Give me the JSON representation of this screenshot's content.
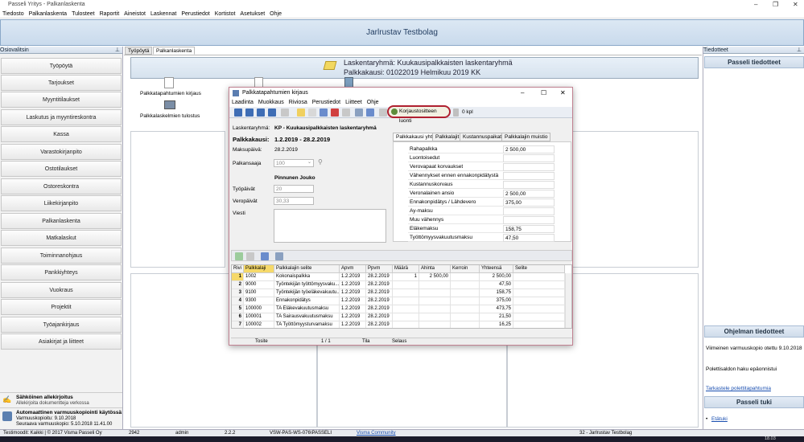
{
  "window": {
    "title": "Passeli Yritys - Palkanlaskenta"
  },
  "menu": [
    "Tiedosto",
    "Palkanlaskenta",
    "Tulosteet",
    "Raportit",
    "Aineistot",
    "Laskennat",
    "Perustiedot",
    "Kortistot",
    "Asetukset",
    "Ohje"
  ],
  "banner": "Jarlrustav Testbolag",
  "left": {
    "title": "Osiovalitsin",
    "items": [
      "Työpöytä",
      "Tarjoukset",
      "Myyntitilaukset",
      "Laskutus ja myyntireskontra",
      "Kassa",
      "Varastokirjanpito",
      "Ostotilaukset",
      "Ostoreskontra",
      "Liikekirjanpito",
      "Palkanlaskenta",
      "Matkalaskut",
      "Toiminnanohjaus",
      "Pankkiyhteys",
      "Vuokraus",
      "Projektit",
      "Työajankirjaus",
      "Asiakirjat ja liitteet"
    ],
    "notice1": {
      "title": "Sähköinen allekirjoitus",
      "text": "Allekirjoita dokumentteja verkossa"
    },
    "notice2": {
      "title": "Automaattinen varmuuskopiointi käytössä",
      "l1": "Varmuuskopioitu: 9.10.2018",
      "l2": "Seuraava varmuuskopio: 5.10.2018 11.41.00"
    }
  },
  "tabs": [
    "Työpöytä",
    "Palkanlaskenta"
  ],
  "header": {
    "l1": "Laskentaryhmä: Kuukausipalkkaisten laskentaryhmä",
    "l2": "Palkkakausi: 01022019 Helmikuu 2019 KK"
  },
  "desk": {
    "i1": "Palkkatapahtumien kirjaus",
    "i2": "Palkkalaskelmien tulostus"
  },
  "right": {
    "title": "Tiedotteet",
    "h1": "Passeli tiedotteet",
    "h2": "Ohjelman tiedotteet",
    "t1": "Viimeinen varmuuskopio otettu 9.10.2018",
    "t2": "Polettisaldon haku epäonnistui",
    "link": "Tarkastele polettitapahtumia",
    "h3": "Passeli tuki",
    "bullet": "Etätuki"
  },
  "status": {
    "a": "Testimoodit: Kaikki | © 2017 Visma Passeli Oy",
    "b": "2942",
    "c": "admin",
    "d": "2.2.2",
    "e": "VSW-PAS-WS-076\\PASSELI",
    "f": "Visma Community",
    "g": "32 - Jarlrustav Testbolag"
  },
  "taskbar": {
    "time": "18.03"
  },
  "dlg": {
    "title": "Palkkatapahtumien kirjaus",
    "menu": [
      "Laadinta",
      "Muokkaus",
      "Riviosa",
      "Perustiedot",
      "Liitteet",
      "Ohje"
    ],
    "corr": "Korjaustositteen luonti",
    "count": "0 kpl",
    "lbl_lr": "Laskentaryhmä:",
    "val_lr": "KP - Kuukausipalkkaisten laskentaryhmä",
    "lbl_pk": "Palkkakausi:",
    "val_pk": "1.2.2019 - 28.2.2019",
    "lbl_mp": "Maksupäivä:",
    "val_mp": "28.2.2019",
    "lbl_ps": "Palkansaaja",
    "val_ps": "100",
    "name": "Pinnunen Jouko",
    "lbl_tp": "Työpäivät",
    "val_tp": "20",
    "lbl_vp": "Veropäivät",
    "val_vp": "30,33",
    "lbl_vi": "Viesti",
    "subtabs": [
      "Palkkakausi yht.",
      "Palkkalajit",
      "Kustannuspaikat",
      "Palkkalajin muistio"
    ],
    "summary": [
      [
        "Rahapalkka",
        "2 500,00"
      ],
      [
        "Luontoisedut",
        ""
      ],
      [
        "Verovapaat korvaukset",
        ""
      ],
      [
        "Vähennykset ennen ennakonpidätystä",
        ""
      ],
      [
        "Kustannuskorvaus",
        ""
      ],
      [
        "Veronalainen ansio",
        "2 500,00"
      ],
      [
        "Ennakonpidätys / Lähdevero",
        "375,00"
      ],
      [
        "Ay-maksu",
        ""
      ],
      [
        "Muu vähennys",
        ""
      ],
      [
        "Eläkemaksu",
        "158,75"
      ],
      [
        "Työttömyysvakuutusmaksu",
        "47,50"
      ]
    ],
    "cols": [
      "Rivi",
      "Palkkalaji",
      "Palkkalajin selite",
      "Apvm",
      "Ppvm",
      "Määrä",
      "Ahinta",
      "Kerroin",
      "Yhteensä",
      "Selite"
    ],
    "rows": [
      [
        "1",
        "1002",
        "Kokonaispalkka",
        "1.2.2019",
        "28.2.2019",
        "1",
        "2 500,00",
        "",
        "2 500,00",
        ""
      ],
      [
        "2",
        "9000",
        "Työntekijän työttömyysvaku...",
        "1.2.2019",
        "28.2.2019",
        "",
        "",
        "",
        "47,50",
        ""
      ],
      [
        "3",
        "9100",
        "Työntekijän työeläkevakuutu...",
        "1.2.2019",
        "28.2.2019",
        "",
        "",
        "",
        "158,75",
        ""
      ],
      [
        "4",
        "9300",
        "Ennakonpidätys",
        "1.2.2019",
        "28.2.2019",
        "",
        "",
        "",
        "375,00",
        ""
      ],
      [
        "5",
        "100000",
        "TA Eläkevakuutusmaksu",
        "1.2.2019",
        "28.2.2019",
        "",
        "",
        "",
        "473,75",
        ""
      ],
      [
        "6",
        "100001",
        "TA Sairausvakuutusmaksu",
        "1.2.2019",
        "28.2.2019",
        "",
        "",
        "",
        "21,50",
        ""
      ],
      [
        "7",
        "100002",
        "TA Työttömyysturvamaksu",
        "1.2.2019",
        "28.2.2019",
        "",
        "",
        "",
        "16,25",
        ""
      ]
    ],
    "bstatus": {
      "a": "Tosite",
      "b": "1 / 1",
      "c": "Tila",
      "d": "Selaus"
    }
  }
}
